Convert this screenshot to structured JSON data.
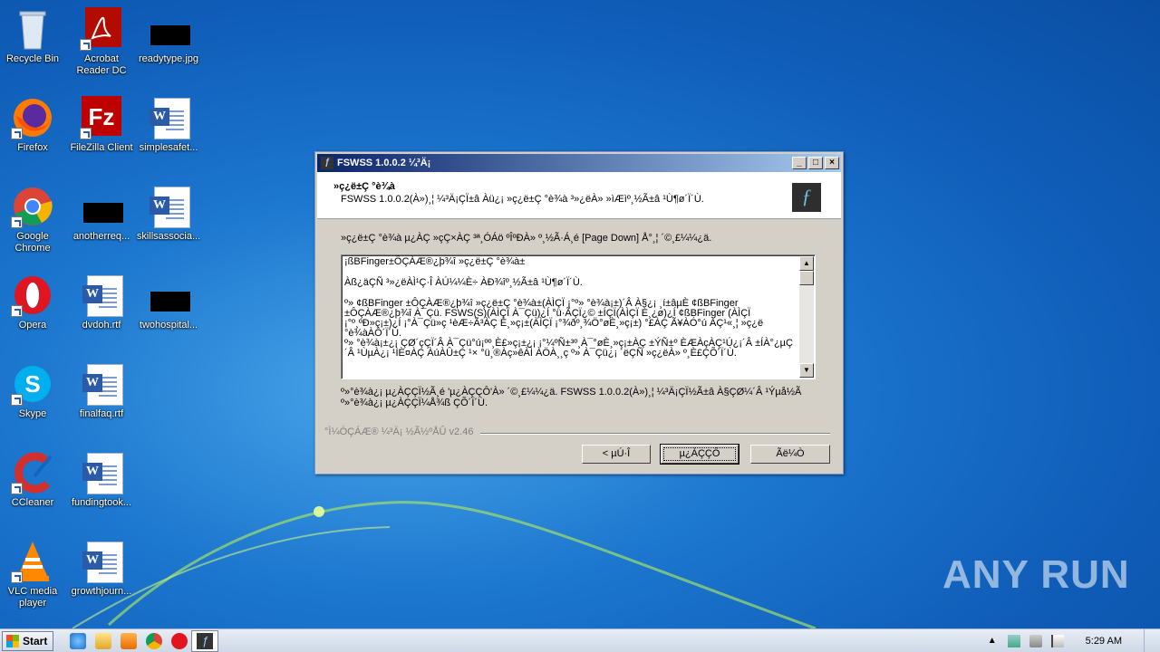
{
  "desktop": {
    "icons": [
      {
        "label": "Recycle Bin",
        "icon": "recycle-bin-icon"
      },
      {
        "label": "Acrobat Reader DC",
        "icon": "acrobat-icon"
      },
      {
        "label": "readytype.jpg",
        "icon": "image-file-icon"
      },
      {
        "label": "Firefox",
        "icon": "firefox-icon"
      },
      {
        "label": "FileZilla Client",
        "icon": "filezilla-icon"
      },
      {
        "label": "simplesafet...",
        "icon": "word-doc-icon"
      },
      {
        "label": "Google Chrome",
        "icon": "chrome-icon"
      },
      {
        "label": "anotherreq...",
        "icon": "image-file-icon"
      },
      {
        "label": "skillsassocia...",
        "icon": "word-doc-icon"
      },
      {
        "label": "Opera",
        "icon": "opera-icon"
      },
      {
        "label": "dvdoh.rtf",
        "icon": "word-doc-icon"
      },
      {
        "label": "twohospital...",
        "icon": "image-file-icon"
      },
      {
        "label": "Skype",
        "icon": "skype-icon"
      },
      {
        "label": "finalfaq.rtf",
        "icon": "word-doc-icon"
      },
      {
        "label": "CCleaner",
        "icon": "ccleaner-icon"
      },
      {
        "label": "fundingtook...",
        "icon": "word-doc-icon"
      },
      {
        "label": "VLC media player",
        "icon": "vlc-icon"
      },
      {
        "label": "growthjourn...",
        "icon": "word-doc-icon"
      }
    ]
  },
  "dialog": {
    "title": "FSWSS 1.0.0.2 ¼³Ä¡",
    "header_title": "»ç¿ë±Ç °è¾à",
    "header_subtitle": "FSWSS 1.0.0.2(À»)¸¦ ¼³Ä¡ÇÏ±â Àü¿¡ »ç¿ë±Ç °è¾à ³»¿ëÀ» »ìÆìº¸½Ã±â ¹Ù¶ø´Ï´Ù.",
    "instruction": "»ç¿ë±Ç °è¾à µ¿ÀÇ »çÇ×ÀÇ ³ª¸ÓÁö ºÎºÐÀ» º¸½Ã·Á¸é [Page Down] Å°¸¦ ´©¸£¼¼¿ä.",
    "license_paragraphs": [
      "¡ßBFinger±ÔÇÀÆ®¿þ¾î »ç¿ë±Ç °è¾à±",
      "Àß¿äÇÑ ³»¿ëÀÌ¹Ç·Î ÀÚ¼¼È÷ ÀÐ¾îº¸½Ã±â ¹Ù¶ø´Ï´Ù.",
      "º» ¢ßBFinger ±ÔÇÀÆ®¿þ¾î »ç¿ë±Ç °è¾à±(ÀÌÇÏ ¡°º» °è¾à¡±)´Â À§¿¡ ¸í±âµÈ ¢ßBFinger ±ÔÇÀÆ®¿þ¾î À¯Çü. FSWS(S)(ÀÌÇÏ À¯Çü)¿Í °ü·ÃÇÏ¿© ±ÍÇÏ(ÀÌÇÏ È¸¿ø)¿Í ¢ßBFinger (ÀÌÇÏ ¡°º¸ºÐ»ç¡±)¿Í ¡°À¯Çü»ç ¹èÆ÷Ã³ÀÇ È¸»ç¡±(ÀÌÇÏ ¡°¾ðº¸¾Ö°øÈ¸»ç¡±) °£ÀÇ Ã¥ÀÓ°ú ÀÇ¹«¸¦ »ç¿ë °è¾àÀÔ´Ï´Ù.",
      "º» °è¾à¡±¿¡ ÇØ´çÇÏ´Â À¯Çü°ú¡ºº¸È£»ç¡±¿¡ ¡°¼ºÑ±³º¸À¯°øÈ¸»ç¡±ÀÇ ±ÝÑ±º ÈÆÀçÀÇ¹Ú¿¡´Â ±ÍÀ°¿µÇ´Â ¹ÙµÀ¿¡ ¹ÌÈ¤ÀÇ ÀúÀÛ±Ç ¹× °ü¸®Àç»êÀÌ ÀÖÀ¸¸ç º» À¯Çü¿¡ ´ëÇÑ »ç¿ëÀ» º¸È£ÇÕ´Ï´Ù."
    ],
    "footer_text": "º»°è¾à¿¡ µ¿ÀÇÇÏ½Ã¸é 'µ¿ÀÇÇÔ'À» ´©¸£¼¼¿ä. FSWSS 1.0.0.2(À»)¸¦ ¼³Ä¡ÇÏ½Ã±â À§ÇØ¼­´Â ¹Ýµå½Ã º»°è¾à¿¡ µ¿ÀÇÇÏ¼Å¾ß ÇÕ´Ï´Ù.",
    "branding": "°Ì¼ÒÇÁÆ® ¼³Ä¡ ½Ã½ºÅÛ v2.46",
    "buttons": {
      "back": "< µÚ·Î",
      "agree": "µ¿ÀÇÇÔ",
      "cancel": "Ãë¼Ò"
    }
  },
  "watermark": "ANY RUN",
  "taskbar": {
    "start_label": "Start",
    "clock": "5:29 AM"
  }
}
